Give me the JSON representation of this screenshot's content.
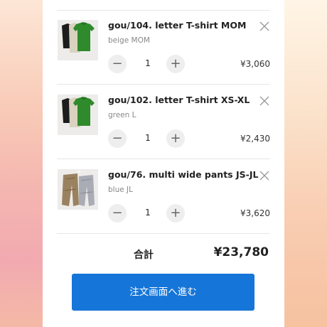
{
  "cart": {
    "items": [
      {
        "title": "gou/104. letter T-shirt MOM",
        "variant": "beige MOM",
        "quantity": "1",
        "price": "¥3,060",
        "minus_label": "−",
        "plus_label": "+",
        "thumbnail": "t-shirt-product-photo"
      },
      {
        "title": "gou/102. letter T-shirt XS-XL",
        "variant": "green L",
        "quantity": "1",
        "price": "¥2,430",
        "minus_label": "−",
        "plus_label": "+",
        "thumbnail": "t-shirt-product-photo"
      },
      {
        "title": "gou/76. multi wide pants JS-JL",
        "variant": "blue JL",
        "quantity": "1",
        "price": "¥3,620",
        "minus_label": "−",
        "plus_label": "+",
        "thumbnail": "pants-product-photo"
      }
    ],
    "total_label": "合計",
    "total_value": "¥23,780",
    "checkout_label": "注文画面へ進む"
  },
  "colors": {
    "accent": "#1675d8",
    "divider": "#e6e6e6",
    "qty_button_bg": "#eeeeee"
  }
}
